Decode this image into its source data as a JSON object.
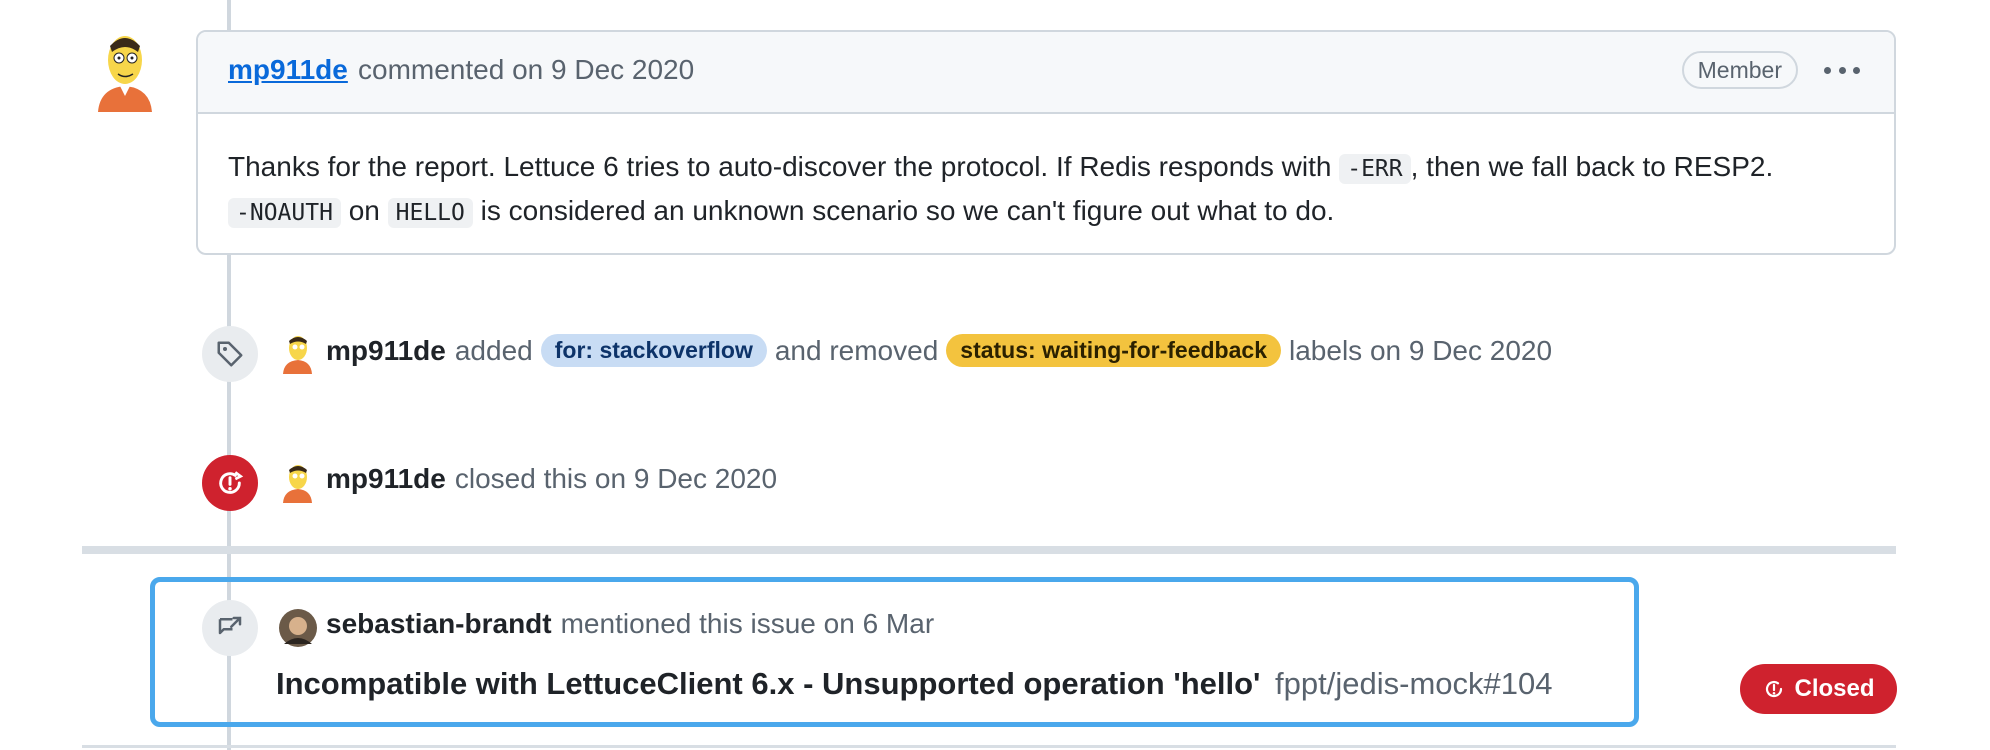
{
  "comment": {
    "author": "mp911de",
    "meta": "commented on 9 Dec 2020",
    "badge": "Member",
    "body": {
      "l1_a": "Thanks for the report. Lettuce 6 tries to auto-discover the protocol. If Redis responds with ",
      "l1_code": "-ERR",
      "l1_b": ", then we fall back to RESP2.",
      "l2_code1": "-NOAUTH",
      "l2_a": " on ",
      "l2_code2": "HELLO",
      "l2_b": " is considered an unknown scenario so we can't figure out what to do."
    }
  },
  "label_event": {
    "user": "mp911de",
    "added": "added",
    "added_label": "for: stackoverflow",
    "removed": "and removed",
    "removed_label": "status: waiting-for-feedback",
    "suffix": "labels on 9 Dec 2020"
  },
  "close_event": {
    "user": "mp911de",
    "text": "closed this on 9 Dec 2020"
  },
  "mention_event": {
    "user": "sebastian-brandt",
    "text": "mentioned this issue on 6 Mar",
    "title": "Incompatible with LettuceClient 6.x - Unsupported operation 'hello'",
    "repo": "fppt/jedis-mock#104",
    "status": "Closed"
  },
  "colors": {
    "link": "#0969da",
    "closed": "#cf222e",
    "label_blue": "#c8dcf4",
    "label_yellow": "#f3c33e",
    "highlight_border": "#4aa8ec"
  }
}
